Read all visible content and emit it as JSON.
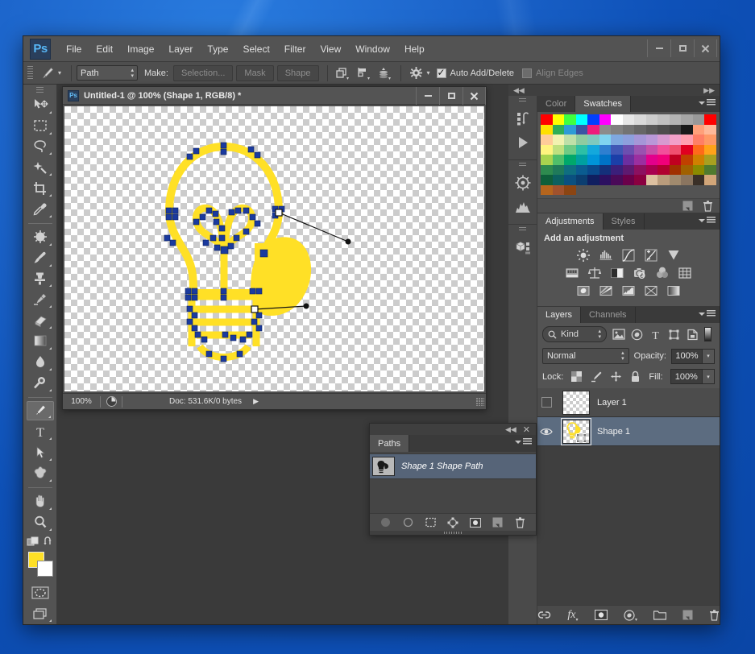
{
  "app": {
    "logo": "Ps",
    "menus": [
      "File",
      "Edit",
      "Image",
      "Layer",
      "Type",
      "Select",
      "Filter",
      "View",
      "Window",
      "Help"
    ],
    "window_controls": [
      "minimize",
      "maximize",
      "close"
    ]
  },
  "options_bar": {
    "tool_icon": "pen-tool-icon",
    "mode_value": "Path",
    "make_label": "Make:",
    "buttons": [
      "Selection...",
      "Mask",
      "Shape"
    ],
    "path_ops_icons": [
      "path-operations-icon",
      "path-alignment-icon",
      "path-arrangement-icon"
    ],
    "gear_icon": "gear-icon",
    "auto_add_delete": {
      "label": "Auto Add/Delete",
      "checked": true
    },
    "align_edges": {
      "label": "Align Edges",
      "checked": false
    }
  },
  "toolbox": {
    "tools": [
      {
        "name": "move-tool",
        "icon": "move"
      },
      {
        "name": "rectangular-marquee-tool",
        "icon": "marquee"
      },
      {
        "name": "lasso-tool",
        "icon": "lasso"
      },
      {
        "name": "quick-selection-tool",
        "icon": "wand"
      },
      {
        "name": "crop-tool",
        "icon": "crop"
      },
      {
        "name": "eyedropper-tool",
        "icon": "eyedropper"
      },
      {
        "name": "spot-healing-brush-tool",
        "icon": "healing"
      },
      {
        "name": "brush-tool",
        "icon": "brush"
      },
      {
        "name": "clone-stamp-tool",
        "icon": "stamp"
      },
      {
        "name": "history-brush-tool",
        "icon": "history-brush"
      },
      {
        "name": "eraser-tool",
        "icon": "eraser"
      },
      {
        "name": "gradient-tool",
        "icon": "gradient"
      },
      {
        "name": "blur-tool",
        "icon": "blur"
      },
      {
        "name": "dodge-tool",
        "icon": "dodge"
      },
      {
        "name": "pen-tool",
        "icon": "pen",
        "active": true
      },
      {
        "name": "type-tool",
        "icon": "type"
      },
      {
        "name": "path-selection-tool",
        "icon": "path-select"
      },
      {
        "name": "custom-shape-tool",
        "icon": "shape"
      },
      {
        "name": "hand-tool",
        "icon": "hand"
      },
      {
        "name": "zoom-tool",
        "icon": "zoom"
      }
    ],
    "foreground_color": "#FFE026",
    "background_color": "#FFFFFF",
    "quick_mask_label": "quick-mask-icon",
    "screen_mode_label": "screen-mode-icon"
  },
  "document": {
    "title": "Untitled-1 @ 100% (Shape 1, RGB/8) *",
    "zoom": "100%",
    "doc_info": "Doc: 531.6K/0 bytes",
    "window_controls": [
      "minimize",
      "maximize",
      "close"
    ]
  },
  "paths_panel": {
    "tab": "Paths",
    "path_name": "Shape 1 Shape Path",
    "footer_buttons": [
      "fill-path-icon",
      "stroke-path-icon",
      "load-selection-icon",
      "make-work-path-icon",
      "add-mask-icon",
      "new-path-icon",
      "delete-path-icon"
    ]
  },
  "color_panel": {
    "tabs": [
      "Color",
      "Swatches"
    ],
    "active_tab": "Swatches",
    "footer_buttons": [
      "new-swatch-icon",
      "delete-swatch-icon"
    ],
    "swatches": [
      [
        "#FF0000",
        "#FFFF00",
        "#40FF40",
        "#00FFFF",
        "#0040FF",
        "#FF00FF",
        "#FFFFFF",
        "#E6E6E6",
        "#D9D9D9",
        "#CCCCCC",
        "#C0C0C0",
        "#B3B3B3",
        "#A6A6A6",
        "#999999",
        "#FF0000"
      ],
      [
        "#FFE000",
        "#2FAE57",
        "#2E9BD6",
        "#3A53A4",
        "#EE1C7B",
        "#8C8C8C",
        "#808080",
        "#737373",
        "#666666",
        "#595959",
        "#4D4D4D",
        "#404040",
        "#1A1A1A",
        "#FFA07A",
        "#FFB899"
      ],
      [
        "#FFCC99",
        "#F2F2B0",
        "#BFE0A8",
        "#8FCBA0",
        "#7FC9BE",
        "#7FD4F0",
        "#7FA8E0",
        "#8D9FDD",
        "#A596D8",
        "#B998D8",
        "#D79AD0",
        "#F2A0C8",
        "#FF9FAF",
        "#FF7F66",
        "#FF9966"
      ],
      [
        "#FFF47F",
        "#BFE07F",
        "#6FCB85",
        "#2DBFA6",
        "#14A8DC",
        "#2E7FD0",
        "#4157B5",
        "#6B4FB0",
        "#9A52B0",
        "#C74FA8",
        "#F24F9A",
        "#F04F6E",
        "#E00020",
        "#FF6A1A",
        "#FFA31A"
      ],
      [
        "#A8D44F",
        "#4FBF6A",
        "#00A86B",
        "#00A0A0",
        "#0095D9",
        "#0072C6",
        "#1B3FA8",
        "#6C2FA0",
        "#9B2FA0",
        "#E3008C",
        "#F0007A",
        "#C00020",
        "#C04000",
        "#D08000",
        "#A8A020"
      ],
      [
        "#2E8B4F",
        "#1F7A5A",
        "#0F6E80",
        "#0B5C90",
        "#0A4A8C",
        "#14307A",
        "#3B1F7A",
        "#5E1A70",
        "#8C1060",
        "#A80050",
        "#B00030",
        "#A03000",
        "#A06000",
        "#8A8A00",
        "#4F7A2E"
      ],
      [
        "#0E5F3A",
        "#0B6060",
        "#0A5080",
        "#0B3E70",
        "#101F60",
        "#2C1060",
        "#4A0A58",
        "#6B004A",
        "#8A0040",
        "#DCC0A0",
        "#B99C7C",
        "#A08A6E",
        "#8A7560",
        "#3A3028",
        "#D2A679"
      ],
      [
        "#B5651D",
        "#A0522D",
        "#8B4513",
        "",
        "",
        "",
        "",
        "",
        "",
        "",
        "",
        "",
        "",
        "",
        ""
      ]
    ]
  },
  "adjustments_panel": {
    "tabs": [
      "Adjustments",
      "Styles"
    ],
    "active_tab": "Adjustments",
    "heading": "Add an adjustment",
    "rows": [
      [
        "brightness-contrast-icon",
        "levels-icon",
        "curves-icon",
        "exposure-icon",
        "vibrance-icon"
      ],
      [
        "hue-saturation-icon",
        "color-balance-icon",
        "black-white-icon",
        "photo-filter-icon",
        "channel-mixer-icon",
        "color-lookup-icon"
      ],
      [
        "invert-icon",
        "posterize-icon",
        "threshold-icon",
        "selective-color-icon",
        "gradient-map-icon"
      ]
    ]
  },
  "layers_panel": {
    "tabs": [
      "Layers",
      "Channels"
    ],
    "active_tab": "Layers",
    "filter_kind_label": "Kind",
    "filter_icons": [
      "pixel-filter-icon",
      "adjustment-filter-icon",
      "type-filter-icon",
      "shape-filter-icon",
      "smartobject-filter-icon"
    ],
    "blend_mode": "Normal",
    "opacity_label": "Opacity:",
    "opacity_value": "100%",
    "lock_label": "Lock:",
    "lock_icons": [
      "lock-transparency-icon",
      "lock-pixels-icon",
      "lock-position-icon",
      "lock-all-icon"
    ],
    "fill_label": "Fill:",
    "fill_value": "100%",
    "layers": [
      {
        "name": "Layer 1",
        "visible": false,
        "selected": false,
        "thumb": "transparent"
      },
      {
        "name": "Shape 1",
        "visible": true,
        "selected": true,
        "thumb": "bulb-shape"
      }
    ],
    "footer_buttons": [
      "link-layers-icon",
      "layer-style-icon",
      "layer-mask-icon",
      "new-fill-adjustment-icon",
      "new-group-icon",
      "new-layer-icon",
      "delete-layer-icon"
    ]
  },
  "icon_dock": {
    "groups": [
      [
        "history-icon",
        "actions-icon"
      ],
      [
        "navigator-icon",
        "histogram-icon"
      ],
      [
        "3d-icon"
      ]
    ]
  },
  "canvas": {
    "artwork": "light-bulb-path",
    "shape_fill": "#FFE026",
    "anchor_color": "#1A3A9E",
    "handle_color": "#111111"
  }
}
